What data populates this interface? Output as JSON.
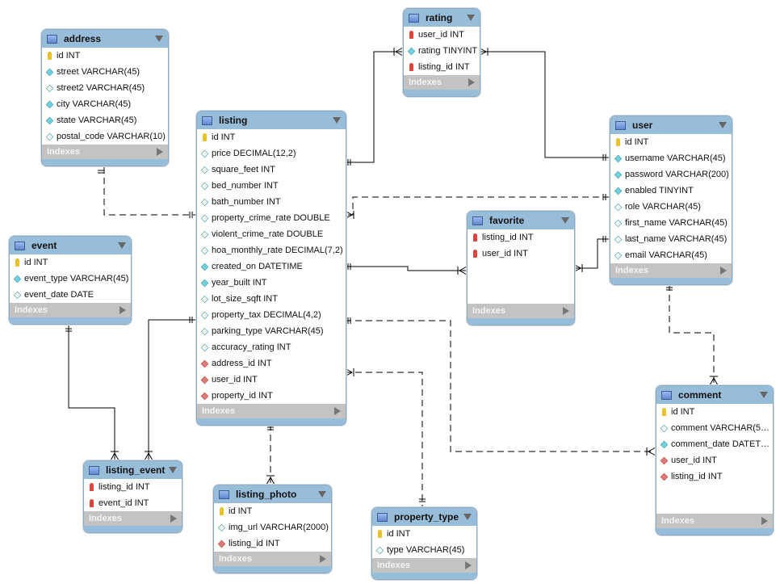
{
  "indexes_label": "Indexes",
  "tables": [
    {
      "name": "address",
      "columns": [
        [
          "id INT",
          "pk"
        ],
        [
          "street VARCHAR(45)",
          "nn"
        ],
        [
          "street2 VARCHAR(45)",
          "hol"
        ],
        [
          "city VARCHAR(45)",
          "nn"
        ],
        [
          "state VARCHAR(45)",
          "nn"
        ],
        [
          "postal_code VARCHAR(10)",
          "hol"
        ]
      ]
    },
    {
      "name": "rating",
      "columns": [
        [
          "user_id INT",
          "pkfk"
        ],
        [
          "rating TINYINT",
          "nn"
        ],
        [
          "listing_id INT",
          "pkfk"
        ]
      ]
    },
    {
      "name": "listing",
      "columns": [
        [
          "id INT",
          "pk"
        ],
        [
          "price DECIMAL(12,2)",
          "hol"
        ],
        [
          "square_feet INT",
          "hol"
        ],
        [
          "bed_number INT",
          "hol"
        ],
        [
          "bath_number INT",
          "hol"
        ],
        [
          "property_crime_rate DOUBLE",
          "hol"
        ],
        [
          "violent_crime_rate DOUBLE",
          "hol"
        ],
        [
          "hoa_monthly_rate DECIMAL(7,2)",
          "hol"
        ],
        [
          "created_on DATETIME",
          "nn"
        ],
        [
          "year_built INT",
          "nn"
        ],
        [
          "lot_size_sqft INT",
          "hol"
        ],
        [
          "property_tax DECIMAL(4,2)",
          "hol"
        ],
        [
          "parking_type VARCHAR(45)",
          "hol"
        ],
        [
          "accuracy_rating INT",
          "hol"
        ],
        [
          "address_id INT",
          "fk"
        ],
        [
          "user_id INT",
          "fk"
        ],
        [
          "property_id INT",
          "fk"
        ]
      ]
    },
    {
      "name": "user",
      "columns": [
        [
          "id INT",
          "pk"
        ],
        [
          "username VARCHAR(45)",
          "nn"
        ],
        [
          "password VARCHAR(200)",
          "nn"
        ],
        [
          "enabled TINYINT",
          "nn"
        ],
        [
          "role VARCHAR(45)",
          "hol"
        ],
        [
          "first_name VARCHAR(45)",
          "hol"
        ],
        [
          "last_name VARCHAR(45)",
          "hol"
        ],
        [
          "email VARCHAR(45)",
          "hol"
        ]
      ]
    },
    {
      "name": "favorite",
      "columns": [
        [
          "listing_id INT",
          "pkfk"
        ],
        [
          "user_id INT",
          "pkfk"
        ]
      ]
    },
    {
      "name": "event",
      "columns": [
        [
          "id INT",
          "pk"
        ],
        [
          "event_type VARCHAR(45)",
          "nn"
        ],
        [
          "event_date DATE",
          "hol"
        ]
      ]
    },
    {
      "name": "comment",
      "columns": [
        [
          "id INT",
          "pk"
        ],
        [
          "comment VARCHAR(5…",
          "hol"
        ],
        [
          "comment_date DATET…",
          "nn"
        ],
        [
          "user_id INT",
          "fk"
        ],
        [
          "listing_id INT",
          "fk"
        ]
      ]
    },
    {
      "name": "listing_event",
      "columns": [
        [
          "listing_id INT",
          "pkfk"
        ],
        [
          "event_id INT",
          "pkfk"
        ]
      ]
    },
    {
      "name": "listing_photo",
      "columns": [
        [
          "id INT",
          "pk"
        ],
        [
          "img_url VARCHAR(2000)",
          "hol"
        ],
        [
          "listing_id INT",
          "fk"
        ]
      ]
    },
    {
      "name": "property_type",
      "columns": [
        [
          "id INT",
          "pk"
        ],
        [
          "type VARCHAR(45)",
          "hol"
        ]
      ]
    }
  ],
  "colors": {
    "header": "#98bdd9",
    "indexes": "#c3c3c3",
    "line": "#000000"
  }
}
